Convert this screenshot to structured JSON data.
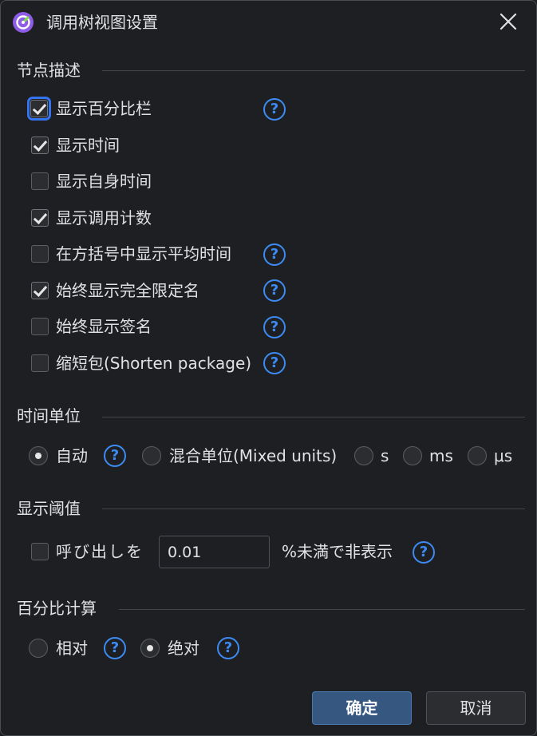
{
  "window": {
    "title": "调用树视图设置",
    "icon": "app-logo-icon",
    "close_icon": "close-icon"
  },
  "sections": {
    "node_desc": {
      "heading": "节点描述",
      "items": [
        {
          "label": "显示百分比栏",
          "checked": true,
          "help": true
        },
        {
          "label": "显示时间",
          "checked": true,
          "help": false
        },
        {
          "label": "显示自身时间",
          "checked": false,
          "help": false
        },
        {
          "label": "显示调用计数",
          "checked": true,
          "help": false
        },
        {
          "label": "在方括号中显示平均时间",
          "checked": false,
          "help": true
        },
        {
          "label": "始终显示完全限定名",
          "checked": true,
          "help": true
        },
        {
          "label": "始终显示签名",
          "checked": false,
          "help": true
        },
        {
          "label": "缩短包(Shorten package)",
          "checked": false,
          "help": true
        }
      ]
    },
    "time_unit": {
      "heading": "时间单位",
      "options": [
        {
          "label": "自动",
          "selected": true
        },
        {
          "label": "混合单位(Mixed units)",
          "selected": false
        },
        {
          "label": "s",
          "selected": false
        },
        {
          "label": "ms",
          "selected": false
        },
        {
          "label": "μs",
          "selected": false
        }
      ]
    },
    "threshold": {
      "heading": "显示阈值",
      "prefix": "呼び出しを",
      "value": "0.01",
      "suffix": "%未満で非表示",
      "checked": false
    },
    "percent_calc": {
      "heading": "百分比计算",
      "options": [
        {
          "label": "相对",
          "selected": false
        },
        {
          "label": "绝对",
          "selected": true
        }
      ]
    }
  },
  "buttons": {
    "ok": "确定",
    "cancel": "取消"
  },
  "help_glyph": "?",
  "colors": {
    "accent": "#3d8bf2",
    "background": "#1e1f22",
    "primary_button": "#365880"
  }
}
